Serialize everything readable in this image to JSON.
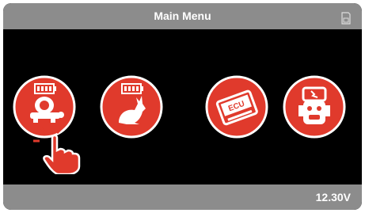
{
  "header": {
    "title": "Main Menu",
    "sd_icon": "sd-card-icon"
  },
  "menu": {
    "items": [
      {
        "name": "low-power-battery",
        "icon": "turtle-battery-icon"
      },
      {
        "name": "high-power-battery",
        "icon": "rabbit-battery-icon"
      },
      {
        "name": "ecu",
        "icon": "ecu-icon",
        "label": "ECU"
      },
      {
        "name": "diagnostic-robot",
        "icon": "robot-head-icon"
      }
    ],
    "accent": "#e03a2c"
  },
  "status": {
    "voltage": "12.30V"
  }
}
